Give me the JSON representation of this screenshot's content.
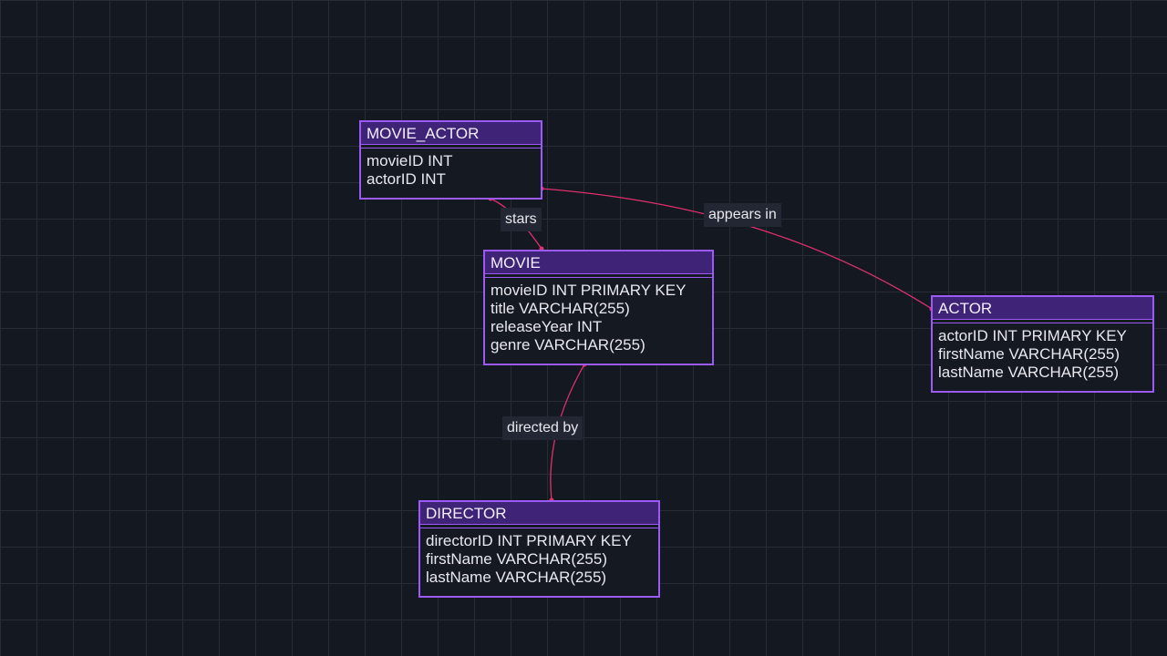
{
  "diagram": {
    "accent_color": "#9b59f5",
    "header_color": "#3e2377",
    "edge_color": "#e0306d",
    "background_color": "#141821",
    "entities": {
      "movie_actor": {
        "name": "MOVIE_ACTOR",
        "fields": [
          "movieID INT",
          "actorID INT"
        ]
      },
      "movie": {
        "name": "MOVIE",
        "fields": [
          "movieID INT PRIMARY KEY",
          "title VARCHAR(255)",
          "releaseYear INT",
          "genre VARCHAR(255)"
        ]
      },
      "actor": {
        "name": "ACTOR",
        "fields": [
          "actorID INT PRIMARY KEY",
          "firstName VARCHAR(255)",
          "lastName VARCHAR(255)"
        ]
      },
      "director": {
        "name": "DIRECTOR",
        "fields": [
          "directorID INT PRIMARY KEY",
          "firstName VARCHAR(255)",
          "lastName VARCHAR(255)"
        ]
      }
    },
    "relationships": {
      "stars": {
        "label": "stars",
        "from": "MOVIE_ACTOR",
        "to": "MOVIE"
      },
      "appears_in": {
        "label": "appears in",
        "from": "MOVIE_ACTOR",
        "to": "ACTOR"
      },
      "directed_by": {
        "label": "directed by",
        "from": "MOVIE",
        "to": "DIRECTOR"
      }
    }
  }
}
